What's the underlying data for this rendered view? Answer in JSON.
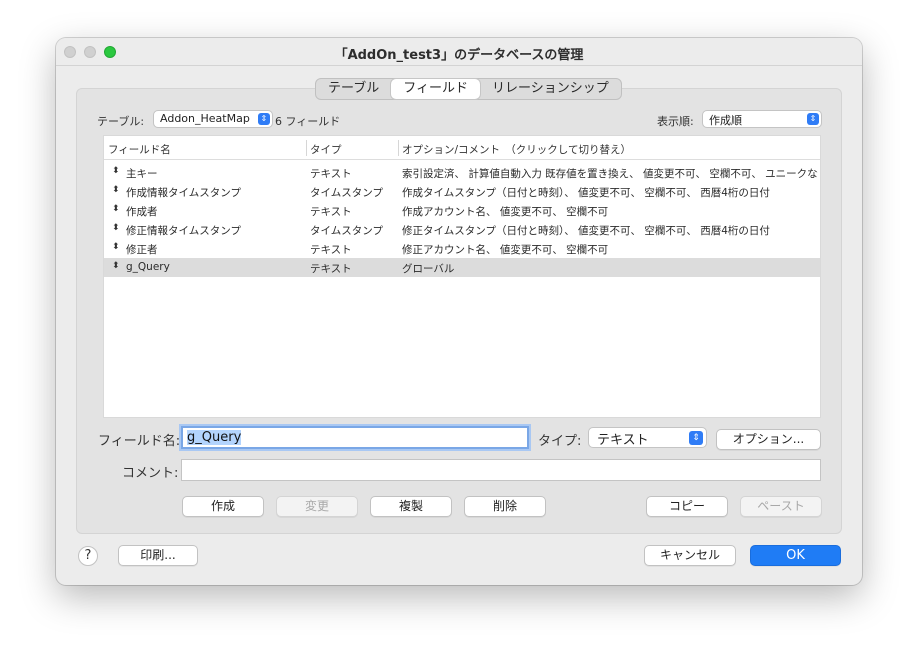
{
  "window": {
    "title": "「AddOn_test3」のデータベースの管理"
  },
  "tabs": [
    {
      "label": "テーブル",
      "active": false
    },
    {
      "label": "フィールド",
      "active": true
    },
    {
      "label": "リレーションシップ",
      "active": false
    }
  ],
  "toolbar": {
    "table_label": "テーブル:",
    "table_value": "Addon_HeatMap",
    "field_count": "6 フィールド",
    "sort_label": "表示順:",
    "sort_value": "作成順"
  },
  "table": {
    "headers": [
      "フィールド名",
      "タイプ",
      "オプション/コメント　（クリックして切り替え）"
    ],
    "rows": [
      {
        "name": "主キー",
        "type": "テキスト",
        "options": "索引設定済、 計算値自動入力  既存値を置き換え、 値変更不可、 空欄不可、 ユニークな値"
      },
      {
        "name": "作成情報タイムスタンプ",
        "type": "タイムスタンプ",
        "options": "作成タイムスタンプ（日付と時刻）、 値変更不可、 空欄不可、 西暦4桁の日付"
      },
      {
        "name": "作成者",
        "type": "テキスト",
        "options": "作成アカウント名、 値変更不可、 空欄不可"
      },
      {
        "name": "修正情報タイムスタンプ",
        "type": "タイムスタンプ",
        "options": "修正タイムスタンプ（日付と時刻）、 値変更不可、 空欄不可、 西暦4桁の日付"
      },
      {
        "name": "修正者",
        "type": "テキスト",
        "options": "修正アカウント名、 値変更不可、 空欄不可"
      },
      {
        "name": "g_Query",
        "type": "テキスト",
        "options": "グローバル",
        "selected": true
      }
    ]
  },
  "form": {
    "field_name_label": "フィールド名:",
    "field_name_value": "g_Query",
    "type_label": "タイプ:",
    "type_value": "テキスト",
    "options_button": "オプション...",
    "comment_label": "コメント:",
    "comment_value": ""
  },
  "actions": {
    "create": "作成",
    "change": "変更",
    "duplicate": "複製",
    "delete": "削除",
    "copy": "コピー",
    "paste": "ペースト"
  },
  "footer": {
    "help": "?",
    "print": "印刷...",
    "cancel": "キャンセル",
    "ok": "OK"
  },
  "colors": {
    "accent": "#1f7cf5",
    "selection_highlight": "#b3d4fd",
    "zoom_button": "#2bc840"
  }
}
